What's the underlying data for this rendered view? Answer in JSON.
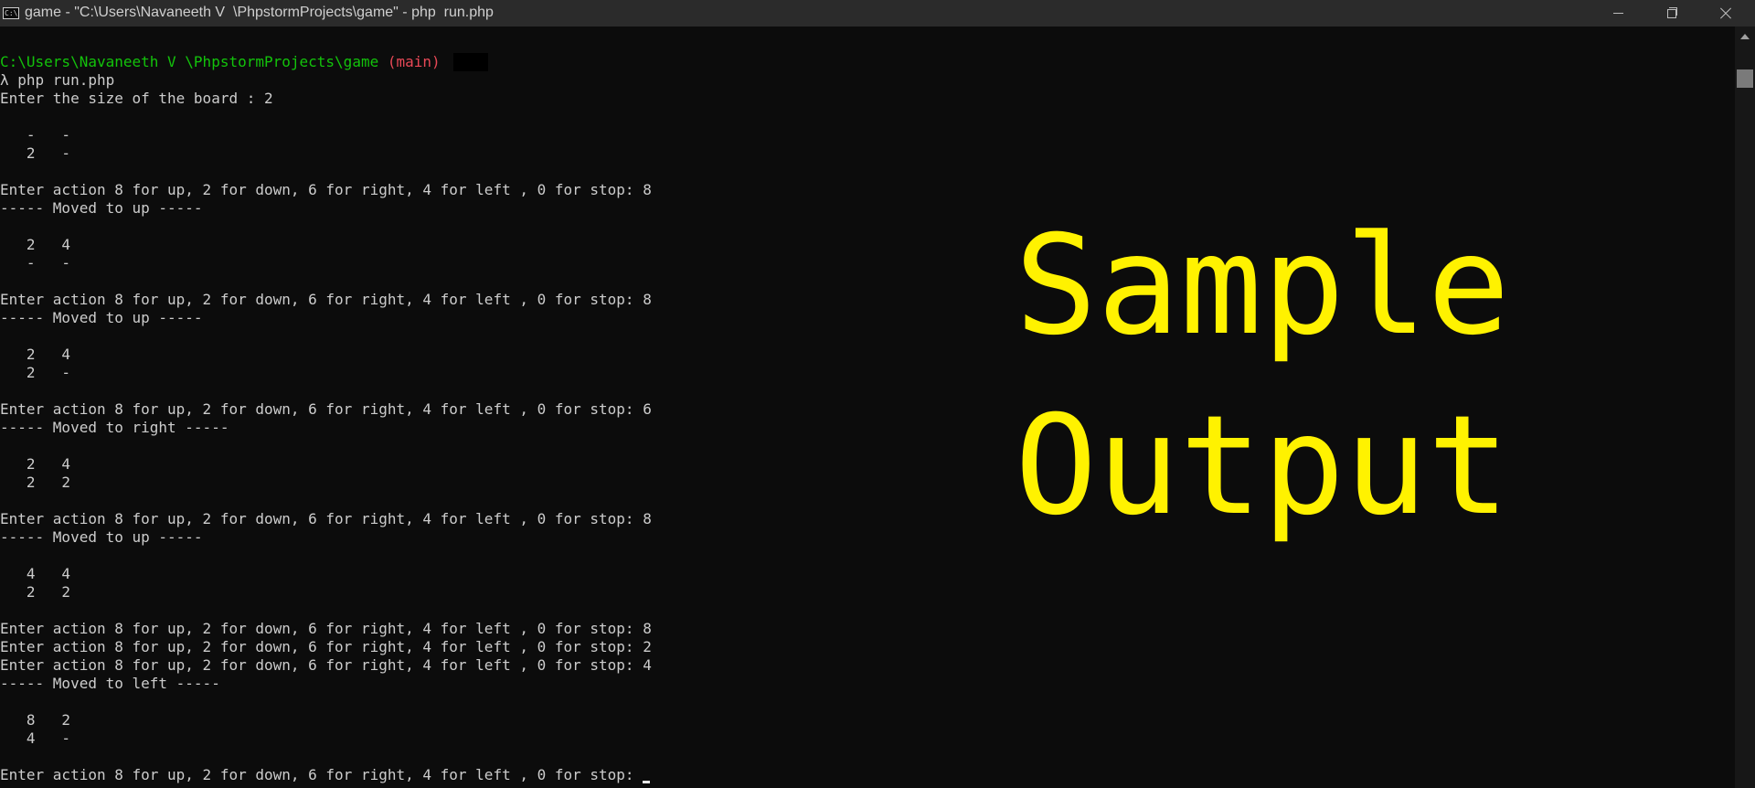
{
  "window": {
    "title": "game - \"C:\\Users\\Navaneeth V  \\PhpstormProjects\\game\" - php  run.php",
    "icon_label": "C:\\"
  },
  "prompt": {
    "path": "C:\\Users\\Navaneeth V \\PhpstormProjects\\game",
    "branch": "(main)",
    "command": "λ php run.php"
  },
  "console_lines": [
    "Enter the size of the board : 2",
    "",
    "   -   -",
    "   2   -",
    "",
    "Enter action 8 for up, 2 for down, 6 for right, 4 for left , 0 for stop: 8",
    "----- Moved to up -----",
    "",
    "   2   4",
    "   -   -",
    "",
    "Enter action 8 for up, 2 for down, 6 for right, 4 for left , 0 for stop: 8",
    "----- Moved to up -----",
    "",
    "   2   4",
    "   2   -",
    "",
    "Enter action 8 for up, 2 for down, 6 for right, 4 for left , 0 for stop: 6",
    "----- Moved to right -----",
    "",
    "   2   4",
    "   2   2",
    "",
    "Enter action 8 for up, 2 for down, 6 for right, 4 for left , 0 for stop: 8",
    "----- Moved to up -----",
    "",
    "   4   4",
    "   2   2",
    "",
    "Enter action 8 for up, 2 for down, 6 for right, 4 for left , 0 for stop: 8",
    "Enter action 8 for up, 2 for down, 6 for right, 4 for left , 0 for stop: 2",
    "Enter action 8 for up, 2 for down, 6 for right, 4 for left , 0 for stop: 4",
    "----- Moved to left -----",
    "",
    "   8   2",
    "   4   -",
    ""
  ],
  "last_prompt": "Enter action 8 for up, 2 for down, 6 for right, 4 for left , 0 for stop: ",
  "overlay": {
    "line1": "Sample",
    "line2": "Output"
  },
  "colors": {
    "background": "#0c0c0c",
    "text": "#cccccc",
    "path": "#13c30b",
    "branch": "#e74856",
    "overlay": "#fff200"
  }
}
